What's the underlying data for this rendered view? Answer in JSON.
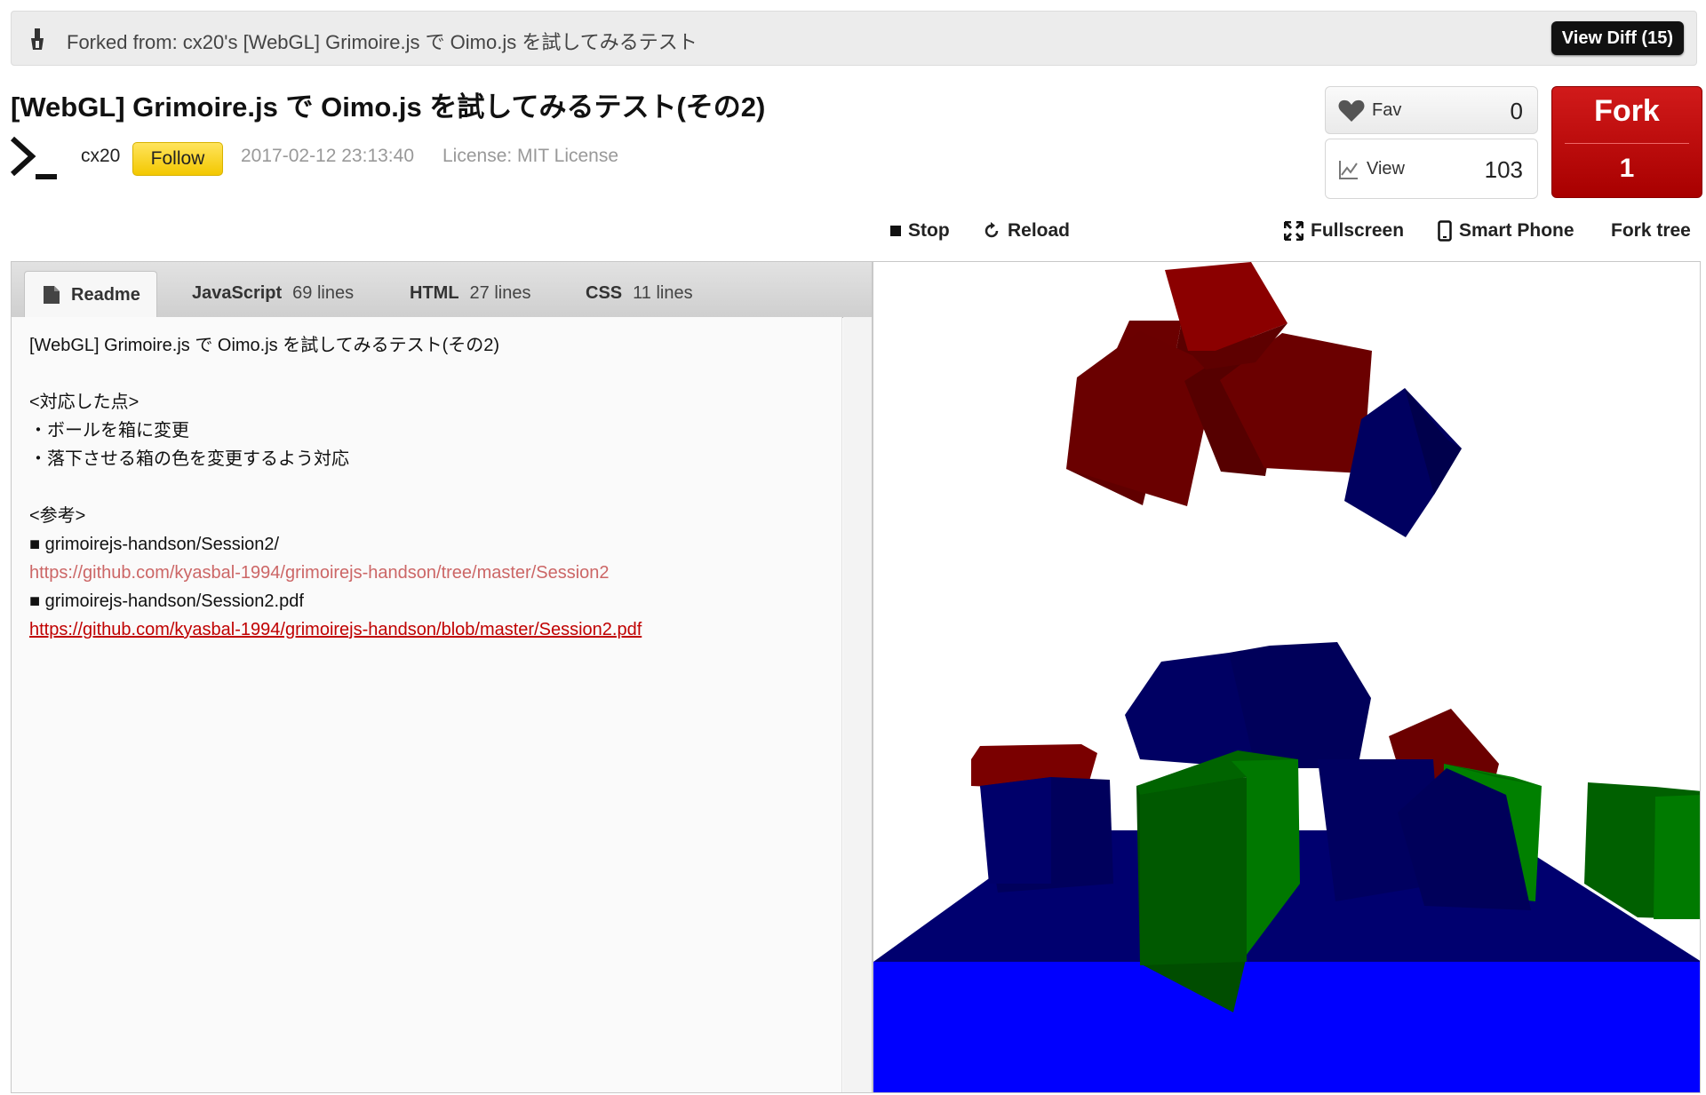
{
  "fork_bar": {
    "forked_from": "Forked from: cx20's [WebGL] Grimoire.js で Oimo.js を試してみるテスト",
    "view_diff_label": "View Diff (15)"
  },
  "title": "[WebGL] Grimoire.js で Oimo.js を試してみるテスト(その2)",
  "author": {
    "username": "cx20",
    "follow_label": "Follow",
    "date": "2017-02-12 23:13:40",
    "license": "License: MIT License"
  },
  "stats": {
    "fav_label": "Fav",
    "fav_count": "0",
    "view_label": "View",
    "view_count": "103",
    "fork_label": "Fork",
    "fork_count": "1"
  },
  "toolbar": {
    "stop_label": "Stop",
    "reload_label": "Reload",
    "fullscreen_label": "Fullscreen",
    "smartphone_label": "Smart Phone",
    "forktree_label": "Fork tree"
  },
  "tabs": [
    {
      "name": "Readme",
      "lines": ""
    },
    {
      "name": "JavaScript",
      "lines": "69 lines"
    },
    {
      "name": "HTML",
      "lines": "27 lines"
    },
    {
      "name": "CSS",
      "lines": "11 lines"
    }
  ],
  "readme": {
    "heading": "[WebGL] Grimoire.js で Oimo.js を試してみるテスト(その2)",
    "section1": "<対応した点>",
    "item1": "・ボールを箱に変更",
    "item2": "・落下させる箱の色を変更するよう対応",
    "section2": "<参考>",
    "ref1_title": "■ grimoirejs-handson/Session2/",
    "ref1_url": "https://github.com/kyasbal-1994/grimoirejs-handson/tree/master/Session2",
    "ref2_title": "■ grimoirejs-handson/Session2.pdf",
    "ref2_url": "https://github.com/kyasbal-1994/grimoirejs-handson/blob/master/Session2.pdf"
  },
  "colors": {
    "fork_red": "#b80000",
    "follow_yellow": "#f5cc00",
    "link_red": "#c00000",
    "floor_blue": "#0000ff",
    "box_red": "#8b0000",
    "box_navy": "#00007a",
    "box_green": "#008000"
  }
}
